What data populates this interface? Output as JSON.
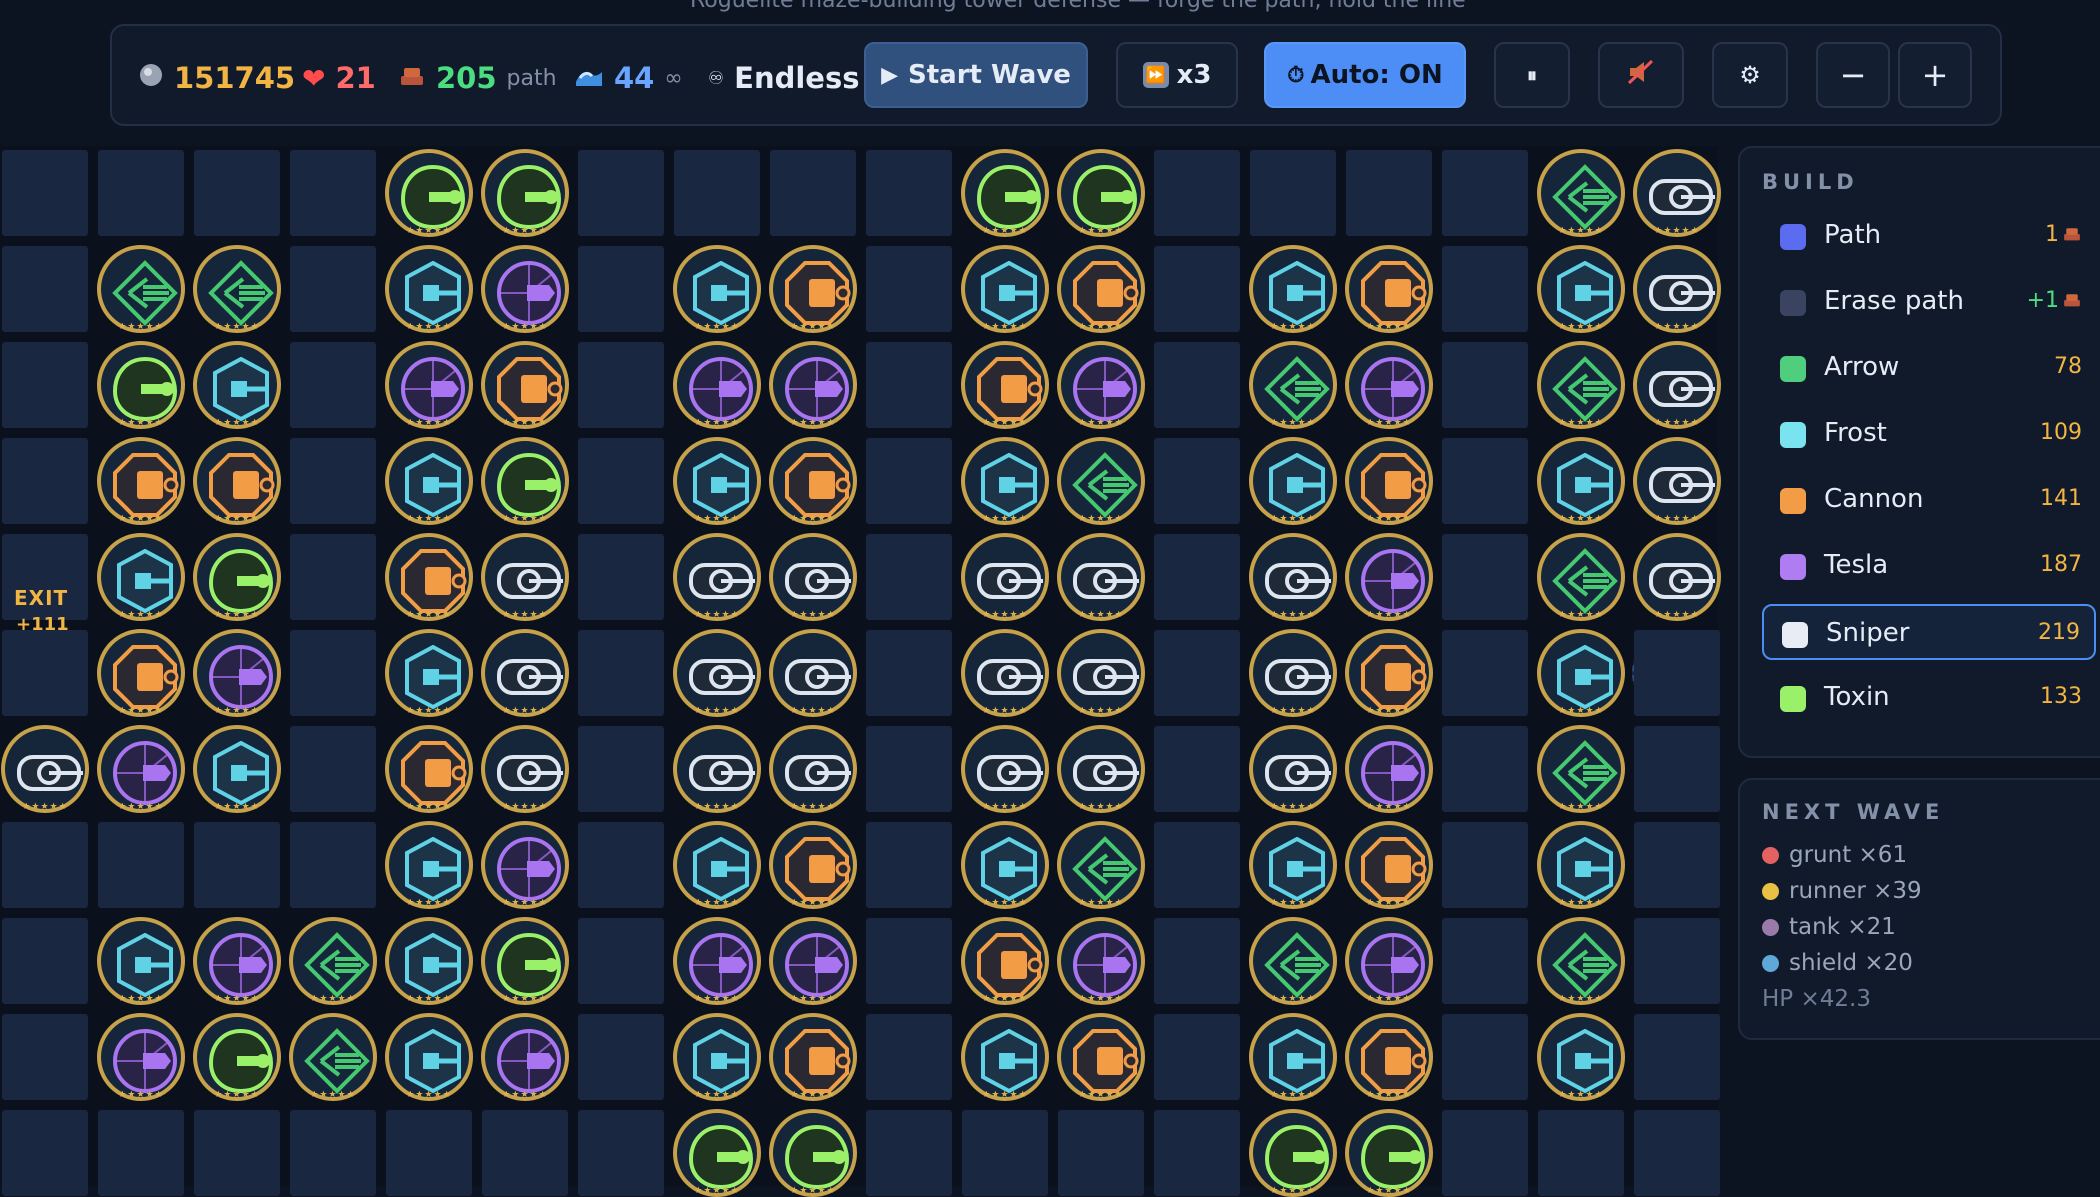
{
  "subtitle": "Roguelite maze-building tower defense — forge the path, hold the line",
  "hud": {
    "gold": "151745",
    "lives": "21",
    "path_count": "205",
    "path_label": "path",
    "wave": "44",
    "wave_suffix": "∞",
    "mode": "Endless",
    "start_wave": "Start Wave",
    "speed": "x3",
    "auto": "Auto: ON",
    "pause": "⏸",
    "minus": "−",
    "plus": "+"
  },
  "colors": {
    "accent": "#4c8df6",
    "gold": "#f2b544",
    "lives": "#ff6b6b",
    "path": "#4ade80",
    "wave": "#6aa6ff",
    "tower_border": "#c8a24a"
  },
  "build": {
    "title": "BUILD",
    "items": [
      {
        "label": "Path",
        "cost": "1",
        "color": "#5b6cf0",
        "cost_color": "#f2b544"
      },
      {
        "label": "Erase path",
        "cost": "+1",
        "color": "#3a4460",
        "cost_color": "#4ade80"
      },
      {
        "label": "Arrow",
        "cost": "78",
        "color": "#4fcf7d",
        "cost_color": "#f2b544"
      },
      {
        "label": "Frost",
        "cost": "109",
        "color": "#7ae3f0",
        "cost_color": "#f2b544"
      },
      {
        "label": "Cannon",
        "cost": "141",
        "color": "#f29d45",
        "cost_color": "#f2b544"
      },
      {
        "label": "Tesla",
        "cost": "187",
        "color": "#b07cf2",
        "cost_color": "#f2b544"
      },
      {
        "label": "Sniper",
        "cost": "219",
        "color": "#e8edf5",
        "cost_color": "#f2b544",
        "selected": true
      },
      {
        "label": "Toxin",
        "cost": "133",
        "color": "#9bf06a",
        "cost_color": "#f2b544"
      }
    ]
  },
  "next_wave": {
    "title": "NEXT WAVE",
    "enemies": [
      {
        "label": "grunt ×61",
        "color": "#e26161"
      },
      {
        "label": "runner ×39",
        "color": "#e8c044"
      },
      {
        "label": "tank ×21",
        "color": "#9a7aa8"
      },
      {
        "label": "shield ×20",
        "color": "#5fa8d8"
      }
    ],
    "hp": "HP ×42.3"
  },
  "exit": {
    "label": "EXIT",
    "reward": "+111"
  },
  "board": {
    "cols": 18,
    "rows": 11,
    "legend": "A=arrow F=frost C=cannon T=tesla S=sniper X=toxin .=empty",
    "map": [
      "....XX....XX....AS",
      ".AA.FT.FC.FC.FC.FS",
      ".XF.TC.TT.CT.AT.AS",
      ".CC.FX.FC.FA.FC.FS",
      ".FX.CS.SS.SS.ST.AS",
      ".CT.FS.SS.SS.SC.F.",
      "STF.CS.SS.SS.ST.A.",
      "....FT.FC.FA.FC.F.",
      ".FTAFX.TT.CT.AT.A.",
      ".TXAFT.FC.FC.FC.F.",
      ".......XX....XX..."
    ]
  }
}
